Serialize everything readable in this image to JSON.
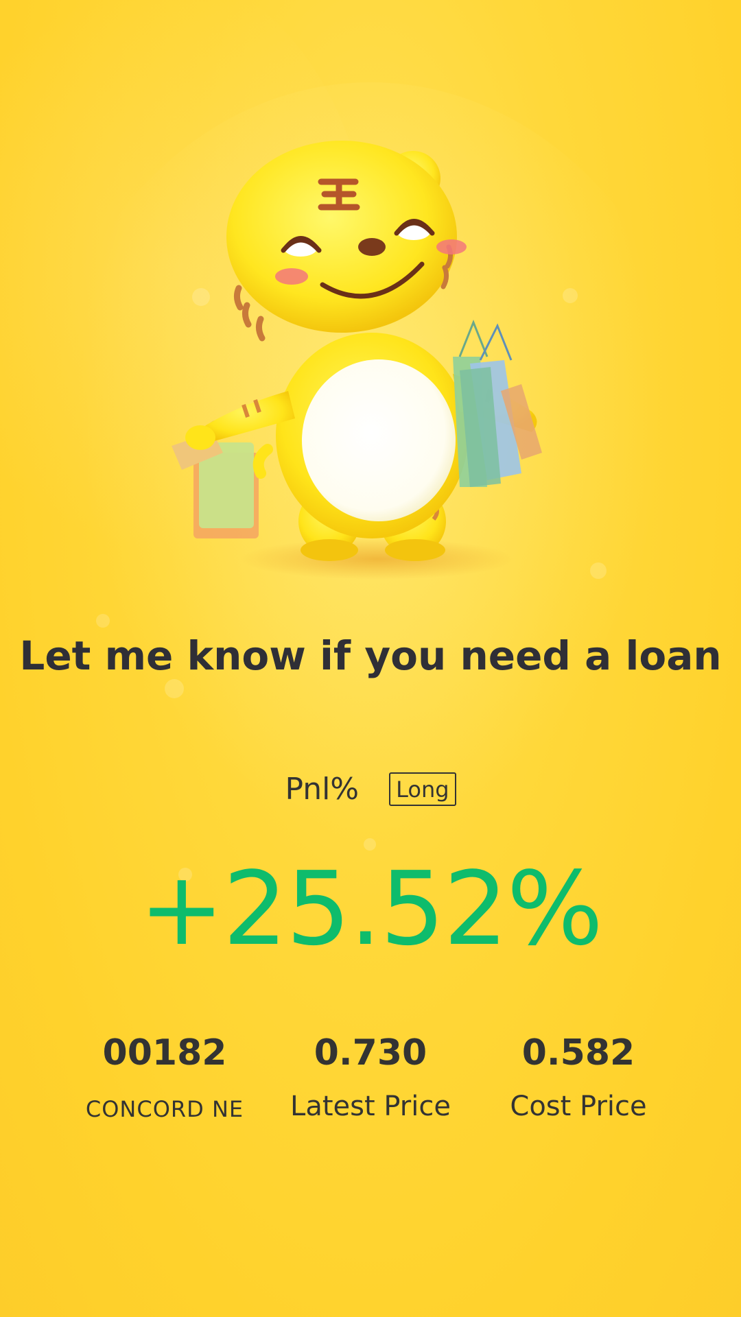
{
  "headline": "Let me know if you need a loan",
  "pnl": {
    "label": "Pnl%",
    "position_badge": "Long",
    "value": "+25.52%"
  },
  "stats": [
    {
      "value": "00182",
      "label": "CONCORD NE"
    },
    {
      "value": "0.730",
      "label": "Latest Price"
    },
    {
      "value": "0.582",
      "label": "Cost Price"
    }
  ],
  "colors": {
    "background": "#ffd83a",
    "gain": "#0ebc6c",
    "text": "#333333"
  },
  "icons": [
    "tiger-mascot-illustration"
  ]
}
